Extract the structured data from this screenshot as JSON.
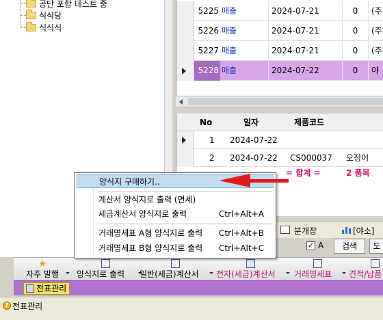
{
  "tree": {
    "items": [
      {
        "label": "공단 포함 테스트 중"
      },
      {
        "label": "식식당"
      },
      {
        "label": "식식식"
      }
    ]
  },
  "upper_grid": {
    "rows": [
      {
        "no": "5225",
        "type": "매출",
        "date": "2024-07-21",
        "zero": "0",
        "last": "(주"
      },
      {
        "no": "5226",
        "type": "매출",
        "date": "2024-07-21",
        "zero": "0",
        "last": "(주"
      },
      {
        "no": "5227",
        "type": "매출",
        "date": "2024-07-21",
        "zero": "0",
        "last": "(주"
      },
      {
        "no": "5228",
        "type": "매출",
        "date": "2024-07-22",
        "zero": "0",
        "last": "야"
      }
    ]
  },
  "lower_grid": {
    "headers": {
      "no": "No",
      "date": "일자",
      "code": "제품코드"
    },
    "rows": [
      {
        "no": "1",
        "date": "2024-07-22",
        "code": "",
        "name": ""
      },
      {
        "no": "2",
        "date": "2024-07-22",
        "code": "CS000037",
        "name": "오징어"
      }
    ],
    "total_label": "= 합계 =",
    "total_value": "2 품목"
  },
  "mid_bar": {
    "book_label": "분개장",
    "report_label": "[야소]"
  },
  "search_row": {
    "check_label": "A",
    "search_label": "검색",
    "next_label": "도"
  },
  "context_menu": {
    "items": [
      {
        "label": "양식지 구매하기..",
        "shortcut": ""
      },
      {
        "label": "계산서 양식지로 출력 (면세)",
        "shortcut": ""
      },
      {
        "label": "세금계산서 양식지로 출력",
        "shortcut": "Ctrl+Alt+A"
      },
      {
        "label": "거래명세표 A형 양식지로 출력",
        "shortcut": "Ctrl+Alt+B"
      },
      {
        "label": "거래명세표 B형 양식지로 출력",
        "shortcut": "Ctrl+Alt+C"
      }
    ]
  },
  "toolbar": {
    "buttons": [
      {
        "label": "자주 발행",
        "icon": "star-icon"
      },
      {
        "label": "양식지로 출력",
        "icon": "form-icon"
      },
      {
        "label": "일반(세금)계산서",
        "icon": "invoice-icon"
      },
      {
        "label": "전자(세금)계산서",
        "icon": "home-tax-icon"
      },
      {
        "label": "거래명세표",
        "icon": "statement-icon"
      },
      {
        "label": "견적/납품",
        "icon": "estimate-icon"
      }
    ]
  },
  "tab_bar": {
    "tab_label": "전표관리"
  },
  "status_bar": {
    "text": "전표관리"
  },
  "colors": {
    "selected_row": "#d9a6e8",
    "selected_no": "#a56cc0",
    "type_text": "#1a35c8",
    "total_text": "#d0106b",
    "menu_highlight": "#c2dcf2",
    "arrow": "#e01b1b",
    "purple_bar": "#b070d0"
  }
}
